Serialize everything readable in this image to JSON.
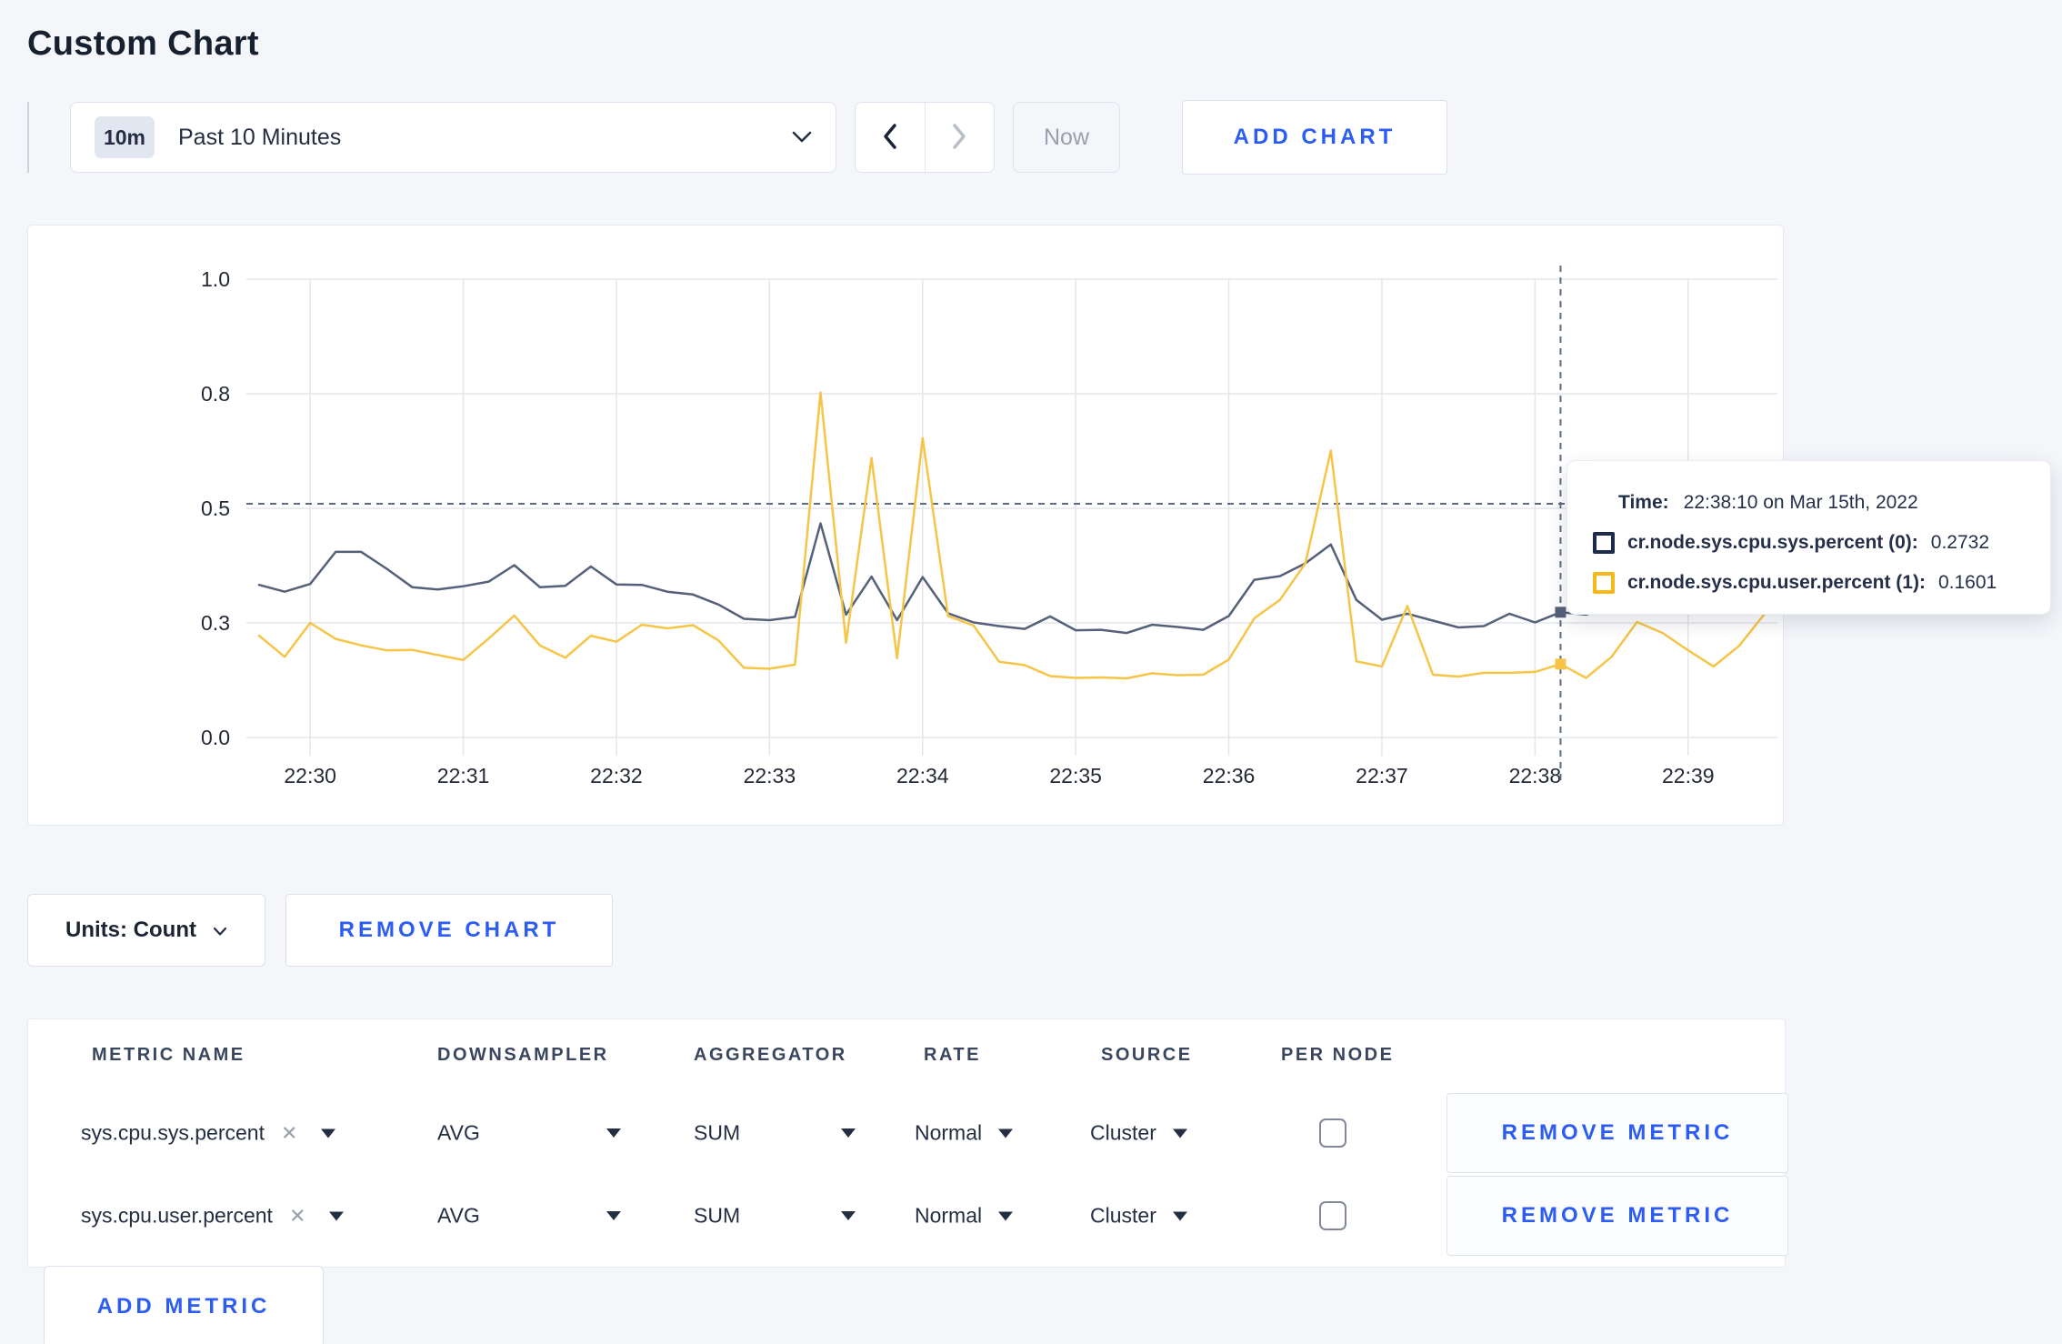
{
  "page": {
    "title": "Custom Chart",
    "background": "#f4f6fa",
    "accent_blue": "#2c5cf2",
    "text_navy": "#242e42"
  },
  "toolbar": {
    "time_range": {
      "badge": "10m",
      "label": "Past 10 Minutes"
    },
    "now_label": "Now",
    "add_chart_label": "ADD CHART"
  },
  "units_bar": {
    "units_label": "Units: Count",
    "remove_chart_label": "REMOVE CHART"
  },
  "chart_data": {
    "type": "line",
    "title": "",
    "xlabel": "",
    "ylabel": "",
    "ylim": [
      0,
      1
    ],
    "grid": true,
    "x_window": [
      "22:29:35",
      "22:39:35"
    ],
    "x_ticks": [
      "22:30",
      "22:31",
      "22:32",
      "22:33",
      "22:34",
      "22:35",
      "22:36",
      "22:37",
      "22:38",
      "22:39"
    ],
    "y_tick_values": [
      0,
      0.25,
      0.5,
      0.75,
      1.0
    ],
    "y_tick_labels": [
      "0.0",
      "0.3",
      "0.5",
      "0.8",
      "1.0"
    ],
    "gridline_color": "#e4e6ec",
    "times": [
      "22:29:40",
      "22:29:50",
      "22:30:00",
      "22:30:10",
      "22:30:20",
      "22:30:30",
      "22:30:40",
      "22:30:50",
      "22:31:00",
      "22:31:10",
      "22:31:20",
      "22:31:30",
      "22:31:40",
      "22:31:50",
      "22:32:00",
      "22:32:10",
      "22:32:20",
      "22:32:30",
      "22:32:40",
      "22:32:50",
      "22:33:00",
      "22:33:10",
      "22:33:20",
      "22:33:30",
      "22:33:40",
      "22:33:50",
      "22:34:00",
      "22:34:10",
      "22:34:20",
      "22:34:30",
      "22:34:40",
      "22:34:50",
      "22:35:00",
      "22:35:10",
      "22:35:20",
      "22:35:30",
      "22:35:40",
      "22:35:50",
      "22:36:00",
      "22:36:10",
      "22:36:20",
      "22:36:30",
      "22:36:40",
      "22:36:50",
      "22:37:00",
      "22:37:10",
      "22:37:20",
      "22:37:30",
      "22:37:40",
      "22:37:50",
      "22:38:00",
      "22:38:10",
      "22:38:20",
      "22:38:30",
      "22:38:40",
      "22:38:50",
      "22:39:00",
      "22:39:10",
      "22:39:20",
      "22:39:30"
    ],
    "series": [
      {
        "name": "cr.node.sys.cpu.sys.percent",
        "color": "#546179",
        "values": [
          0.333,
          0.318,
          0.335,
          0.405,
          0.405,
          0.368,
          0.328,
          0.323,
          0.33,
          0.34,
          0.376,
          0.328,
          0.331,
          0.373,
          0.334,
          0.333,
          0.318,
          0.312,
          0.29,
          0.259,
          0.256,
          0.263,
          0.467,
          0.268,
          0.351,
          0.256,
          0.35,
          0.271,
          0.251,
          0.243,
          0.237,
          0.264,
          0.234,
          0.235,
          0.228,
          0.246,
          0.241,
          0.235,
          0.265,
          0.344,
          0.352,
          0.38,
          0.421,
          0.3,
          0.257,
          0.27,
          0.255,
          0.24,
          0.243,
          0.27,
          0.251,
          0.2732,
          0.268,
          0.288,
          0.3,
          0.298,
          0.296,
          0.3,
          0.289,
          0.272
        ]
      },
      {
        "name": "cr.node.sys.cpu.user.percent",
        "color": "#f6c548",
        "values": [
          0.222,
          0.176,
          0.25,
          0.215,
          0.201,
          0.19,
          0.191,
          0.18,
          0.169,
          0.216,
          0.266,
          0.201,
          0.174,
          0.222,
          0.209,
          0.246,
          0.238,
          0.245,
          0.212,
          0.152,
          0.15,
          0.159,
          0.753,
          0.207,
          0.61,
          0.173,
          0.653,
          0.265,
          0.244,
          0.165,
          0.158,
          0.134,
          0.13,
          0.131,
          0.129,
          0.14,
          0.136,
          0.137,
          0.17,
          0.26,
          0.3,
          0.38,
          0.626,
          0.166,
          0.155,
          0.287,
          0.137,
          0.133,
          0.141,
          0.141,
          0.143,
          0.1601,
          0.13,
          0.176,
          0.252,
          0.228,
          0.19,
          0.155,
          0.2,
          0.27
        ]
      }
    ],
    "crosshair": {
      "time": "22:38:10",
      "value_line": 0.51,
      "line_color": "#5c6b86",
      "points": [
        {
          "series": 0,
          "value": 0.2732
        },
        {
          "series": 1,
          "value": 0.1601
        }
      ]
    },
    "tooltip": {
      "time_label": "Time:",
      "time_value": "22:38:10 on Mar 15th, 2022",
      "series": [
        {
          "label": "cr.node.sys.cpu.sys.percent (0):",
          "value": "0.2732",
          "swatch_color": "#1c2b4a"
        },
        {
          "label": "cr.node.sys.cpu.user.percent (1):",
          "value": "0.1601",
          "swatch_color": "#f5b919"
        }
      ]
    }
  },
  "metrics_table": {
    "columns": [
      "METRIC NAME",
      "DOWNSAMPLER",
      "AGGREGATOR",
      "RATE",
      "SOURCE",
      "PER NODE"
    ],
    "rows": [
      {
        "metric": "sys.cpu.sys.percent",
        "clear_icon": "✕",
        "downsampler": "AVG",
        "aggregator": "SUM",
        "rate": "Normal",
        "source": "Cluster",
        "per_node": false,
        "remove_label": "REMOVE METRIC"
      },
      {
        "metric": "sys.cpu.user.percent",
        "clear_icon": "✕",
        "downsampler": "AVG",
        "aggregator": "SUM",
        "rate": "Normal",
        "source": "Cluster",
        "per_node": false,
        "remove_label": "REMOVE METRIC"
      }
    ],
    "add_metric_label": "ADD METRIC"
  }
}
